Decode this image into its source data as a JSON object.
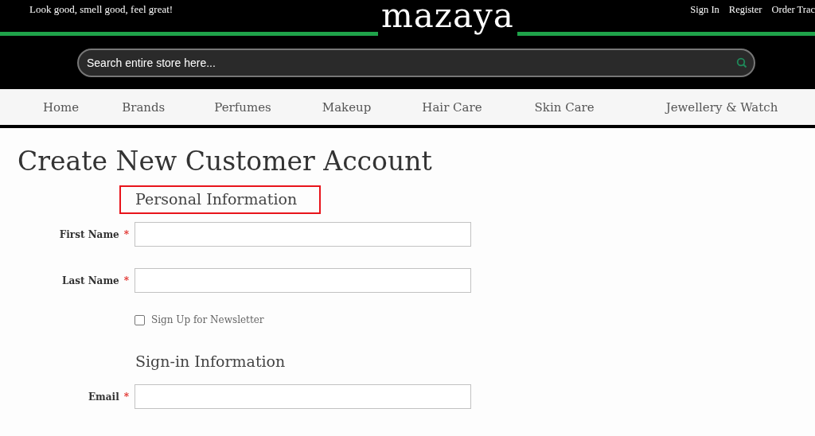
{
  "header": {
    "tagline": "Look good, smell good, feel great!",
    "logo": "mazaya",
    "links": [
      "Sign In",
      "Register",
      "Order Trac"
    ]
  },
  "search": {
    "placeholder": "Search entire store here..."
  },
  "nav": [
    "Home",
    "Brands",
    "Perfumes",
    "Makeup",
    "Hair Care",
    "Skin Care",
    "Jewellery & Watch"
  ],
  "page_title": "Create New Customer Account",
  "sections": [
    {
      "title": "Personal Information",
      "highlighted": true,
      "items": [
        {
          "kind": "field",
          "label": "First Name",
          "required": "*"
        },
        {
          "kind": "field",
          "label": "Last Name",
          "required": "*"
        },
        {
          "kind": "checkbox",
          "label": "Sign Up for Newsletter",
          "checked": false
        }
      ]
    },
    {
      "title": "Sign-in Information",
      "highlighted": false,
      "items": [
        {
          "kind": "field",
          "label": "Email",
          "required": "*"
        }
      ]
    }
  ]
}
